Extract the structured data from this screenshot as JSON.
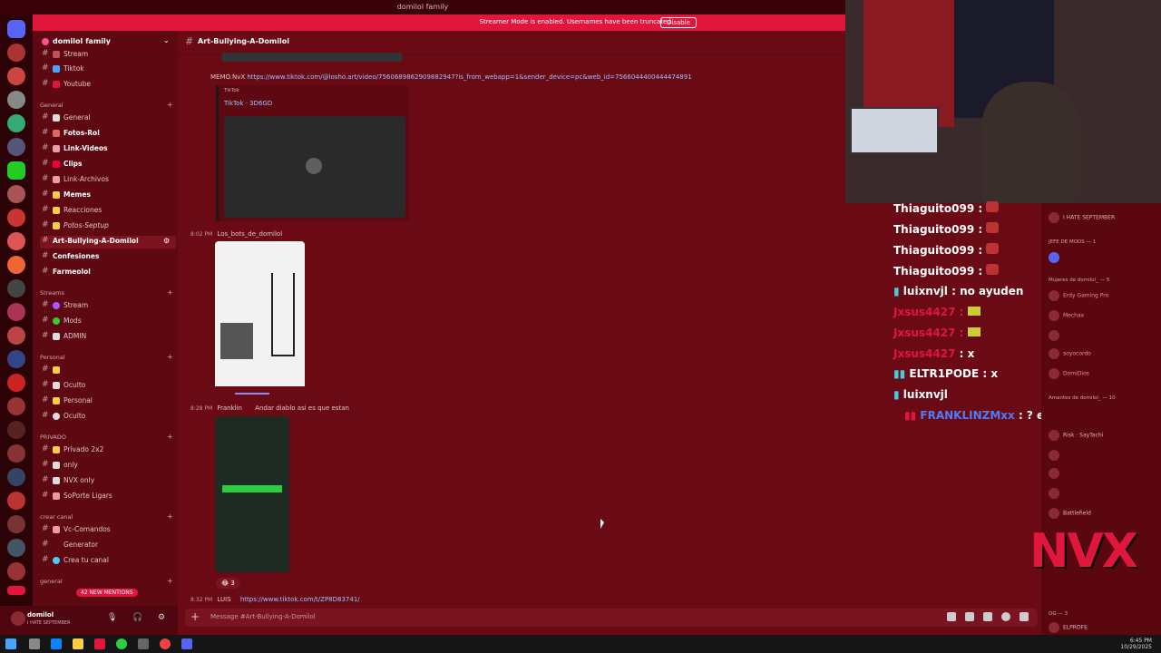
{
  "window": {
    "title": "domilol family"
  },
  "banner": {
    "message": "Streamer Mode is enabled. Usernames have been truncated.",
    "button": "Disable"
  },
  "server": {
    "name": "domilol family"
  },
  "sidebar": {
    "top_channels": [
      {
        "label": "Stream"
      },
      {
        "label": "Tiktok",
        "icon_color": "#4aa3ff"
      },
      {
        "label": "Youtube",
        "icon_color": "#e0163d"
      }
    ],
    "categories": {
      "general": "General",
      "streams": "Streams",
      "personal": "Personal",
      "privado": "PRIVADO",
      "crear": "crear canal",
      "general2": "general"
    },
    "general_channels": [
      {
        "label": "General"
      },
      {
        "label": "Fotos-Rol",
        "bold": true
      },
      {
        "label": "Link-Videos",
        "bold": true
      },
      {
        "label": "Clips",
        "bold": true
      },
      {
        "label": "Link-Archivos"
      },
      {
        "label": "Memes",
        "bold": true
      },
      {
        "label": "Reacciones"
      },
      {
        "label": "Potos-Septup"
      },
      {
        "label": "Art-Bullying-A-Domilol",
        "active": true
      },
      {
        "label": "Confesiones",
        "bold": true
      },
      {
        "label": "Farmeolol",
        "bold": true
      }
    ],
    "stream_channels": [
      {
        "label": "Stream"
      },
      {
        "label": "Mods"
      },
      {
        "label": "ADMIN"
      }
    ],
    "personal_channels": [
      {
        "label": ""
      },
      {
        "label": "Oculto"
      },
      {
        "label": "Personal"
      },
      {
        "label": "Oculto"
      }
    ],
    "privado_channels": [
      {
        "label": "Privado 2x2"
      },
      {
        "label": "only"
      },
      {
        "label": "NVX only"
      },
      {
        "label": "SoPorte Ligars"
      }
    ],
    "crear_channels": [
      {
        "label": "Vc-Comandos"
      },
      {
        "label": "Generator"
      },
      {
        "label": "Crea tu canal"
      }
    ],
    "mentions_badge": "42 NEW MENTIONS",
    "user": {
      "name": "domilol",
      "status": "I HATE SEPTEMBER"
    }
  },
  "chat": {
    "channel": "Art-Bullying-A-Domilol",
    "messages": [
      {
        "author": "MEMO.NvX",
        "link": "https://www.tiktok.com/@losho.art/video/7560689862909882947?is_from_webapp=1&sender_device=pc&web_id=7566044400444474891"
      },
      {
        "embed_source": "TikTok",
        "embed_title": "TikTok · 3D6GD"
      },
      {
        "time": "8:02 PM",
        "author": "Los_bots_de_domilol"
      },
      {
        "time": "8:28 PM",
        "author": "Franklin",
        "text": "Andar diablo asi es que estan"
      },
      {
        "reaction_count": "3"
      },
      {
        "time": "8:32 PM",
        "author": "LUIS",
        "link": "https://www.tiktok.com/t/ZP8D83741/"
      }
    ],
    "composer_placeholder": "Message #Art-Bullying-A-Domilol"
  },
  "stream_chat": [
    {
      "user": "Thiaguito099",
      "text": ":",
      "color": "#ffffff"
    },
    {
      "user": "Thiaguito099",
      "text": ":",
      "color": "#ffffff"
    },
    {
      "user": "Thiaguito099",
      "text": ":",
      "color": "#ffffff"
    },
    {
      "user": "Thiaguito099",
      "text": ":",
      "color": "#ffffff"
    },
    {
      "user": "luixnvjl",
      "text": ": no ayuden",
      "color": "#ffffff"
    },
    {
      "user": "Jxsus4427",
      "text": ":",
      "color": "#e0163d"
    },
    {
      "user": "Jxsus4427",
      "text": ":",
      "color": "#e0163d"
    },
    {
      "user": "Jxsus4427",
      "text": ": x",
      "color": "#e0163d"
    },
    {
      "user": "ELTR1PODE",
      "text": ": x",
      "color": "#ffffff"
    },
    {
      "user": "luixnvjl",
      "text": "",
      "color": "#ffffff"
    },
    {
      "user": "FRANKLINZMxx",
      "text": ": ? el de Gaby no era Iaa",
      "color": "#4a7dff"
    }
  ],
  "members": {
    "status_line": "I HATE SEPTEMBER",
    "jefe_cat": "JEFE DE MODS — 1",
    "mujeres_cat": "Mujeres de domilol_ — 5",
    "amantes_cat": "Amantes de domilol_ — 10",
    "og_cat": "OG — 3",
    "list_a": [
      "Erdy Gaming Pro",
      "Mechax",
      "soyocordo",
      "DomiDios"
    ],
    "list_b": [
      "Risk · SayTachi",
      "",
      "",
      "",
      "Battlefield"
    ],
    "bottom_user": "ELPROFE"
  },
  "overlay": {
    "logo": "NVX"
  },
  "taskbar": {
    "time": "6:45 PM",
    "date": "10/29/2025"
  }
}
